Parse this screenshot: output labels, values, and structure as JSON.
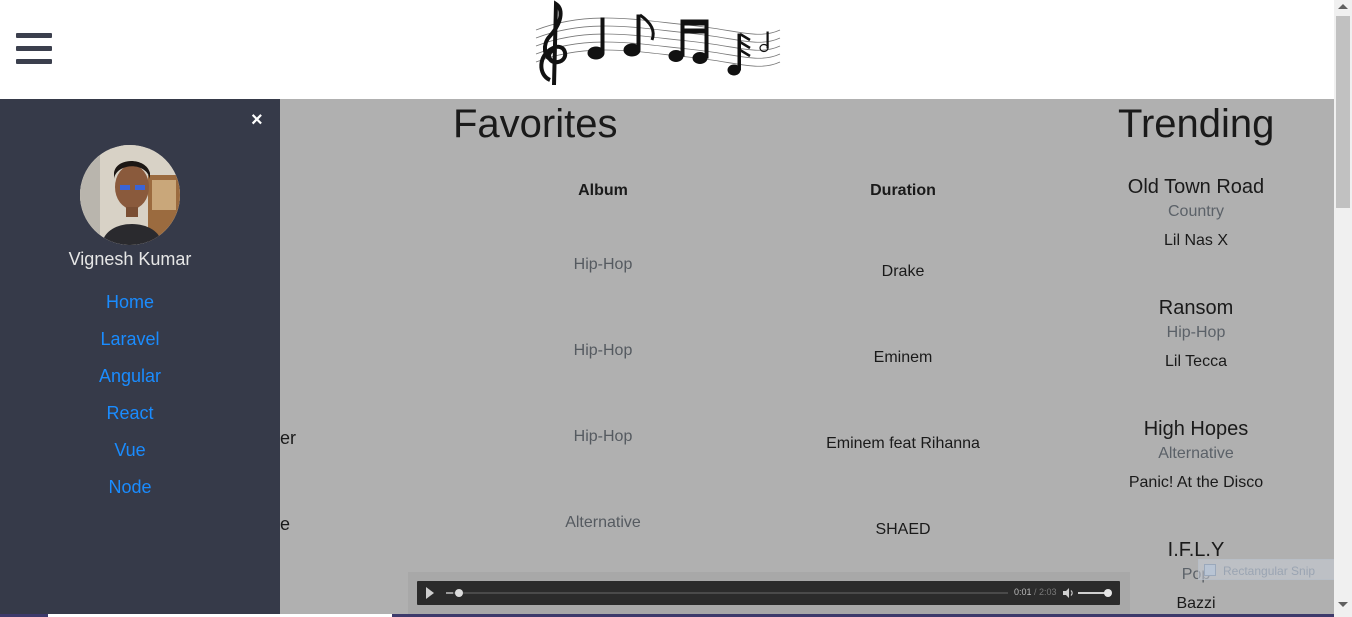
{
  "header": {
    "menu_icon": "hamburger-icon",
    "logo_icon": "music-notes-logo"
  },
  "favorites": {
    "title": "Favorites",
    "columns": [
      "Album",
      "Duration"
    ],
    "rows": [
      {
        "title_fragment": "",
        "album": "Hip-Hop",
        "duration": "Drake"
      },
      {
        "title_fragment": "",
        "album": "Hip-Hop",
        "duration": "Eminem"
      },
      {
        "title_fragment": "er",
        "album": "Hip-Hop",
        "duration": "Eminem feat Rihanna"
      },
      {
        "title_fragment": "e",
        "album": "Alternative",
        "duration": "SHAED"
      }
    ]
  },
  "trending": {
    "title": "Trending",
    "items": [
      {
        "title": "Old Town Road",
        "genre": "Country",
        "artist": "Lil Nas X"
      },
      {
        "title": "Ransom",
        "genre": "Hip-Hop",
        "artist": "Lil Tecca"
      },
      {
        "title": "High Hopes",
        "genre": "Alternative",
        "artist": "Panic! At the Disco"
      },
      {
        "title": "I.F.L.Y",
        "genre": "Pop",
        "artist": "Bazzi"
      }
    ]
  },
  "sidebar": {
    "close_label": "×",
    "user_name": "Vignesh Kumar",
    "nav": [
      "Home",
      "Laravel",
      "Angular",
      "React",
      "Vue",
      "Node"
    ],
    "link_color": "#1a8cff",
    "background": "#363a49"
  },
  "player": {
    "current_time": "0:01",
    "separator": " / ",
    "total_time": "2:03",
    "progress": 0.012,
    "volume": 0.95
  },
  "snip_tooltip": {
    "label": "Rectangular Snip"
  }
}
